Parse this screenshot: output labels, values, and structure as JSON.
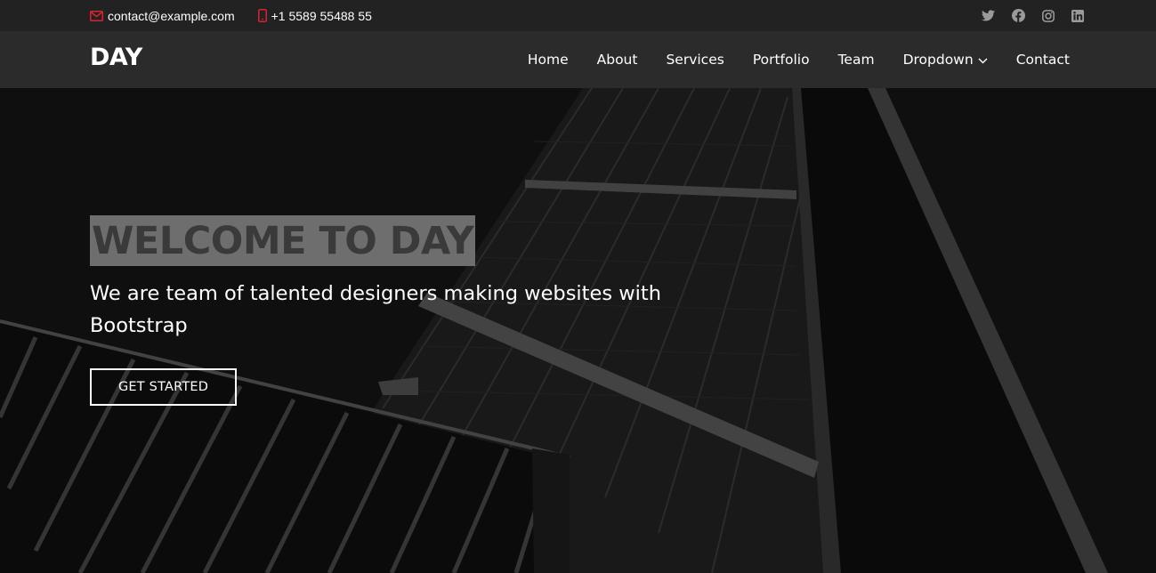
{
  "topbar": {
    "email": "contact@example.com",
    "phone": "+1 5589 55488 55",
    "social_icons": [
      "twitter-icon",
      "facebook-icon",
      "instagram-icon",
      "linkedin-icon"
    ],
    "icon_color": "#d9232d"
  },
  "header": {
    "logo": "DAY",
    "nav": [
      {
        "label": "Home"
      },
      {
        "label": "About"
      },
      {
        "label": "Services"
      },
      {
        "label": "Portfolio"
      },
      {
        "label": "Team"
      },
      {
        "label": "Dropdown"
      },
      {
        "label": "Contact"
      }
    ]
  },
  "hero": {
    "title": "WELCOME TO DAY",
    "subtitle": "We are team of talented designers making websites with Bootstrap",
    "cta": "GET STARTED"
  }
}
